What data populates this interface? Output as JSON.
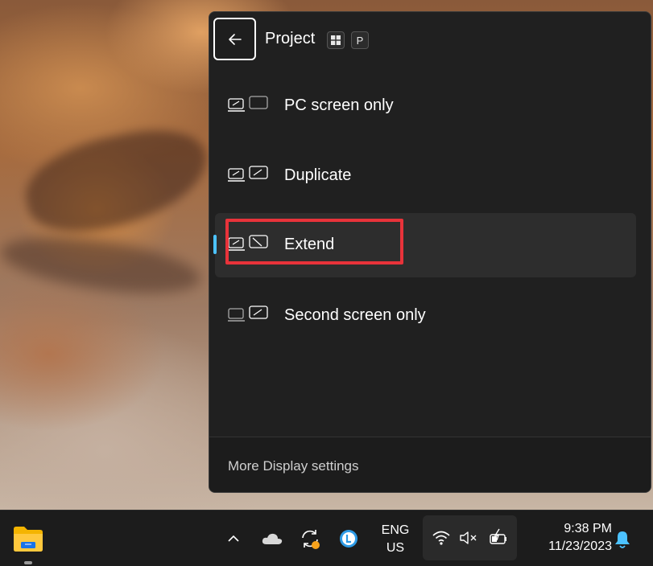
{
  "panel": {
    "title": "Project",
    "shortcut_keys": [
      "⊞",
      "P"
    ],
    "options": [
      {
        "label": "PC screen only",
        "icon": "pc-screen-only-icon",
        "selected": false
      },
      {
        "label": "Duplicate",
        "icon": "duplicate-icon",
        "selected": false
      },
      {
        "label": "Extend",
        "icon": "extend-icon",
        "selected": true
      },
      {
        "label": "Second screen only",
        "icon": "second-screen-only-icon",
        "selected": false
      }
    ],
    "footer_link": "More Display settings"
  },
  "taskbar": {
    "language_line1": "ENG",
    "language_line2": "US",
    "time": "9:38 PM",
    "date": "11/23/2023",
    "icons": [
      "file-explorer-icon",
      "chevron-up-icon",
      "onedrive-cloud-icon",
      "sync-icon",
      "l-app-icon",
      "wifi-icon",
      "speaker-muted-icon",
      "battery-charging-icon",
      "notification-bell-icon"
    ]
  },
  "colors": {
    "accent": "#4cc2ff",
    "highlight_annotation": "#e8333a",
    "panel_bg": "#202020",
    "selected_bg": "#2d2d2d"
  }
}
